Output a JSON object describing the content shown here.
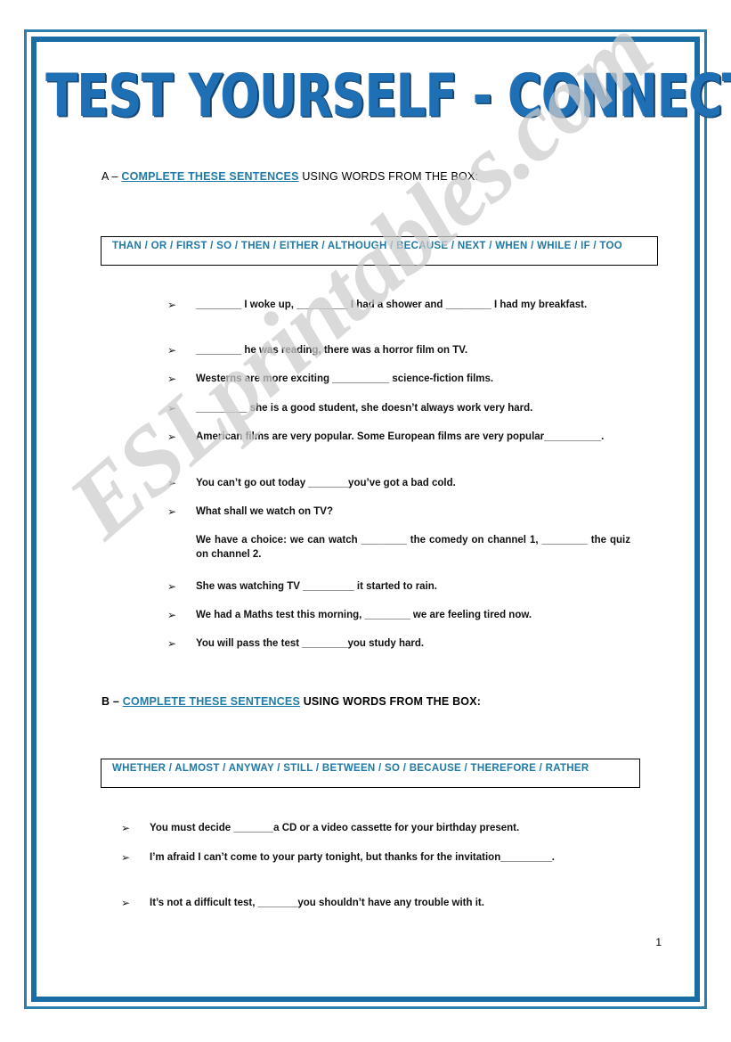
{
  "document": {
    "title": "TEST YOURSELF - CONNECTORS",
    "page_number": "1",
    "watermark": "ESLprintables.com",
    "accent_blue": "#1f6fb5",
    "wordbox_blue": "#2079a6",
    "frame_blue": "#1a6ca4"
  },
  "sections": [
    {
      "label": "A",
      "heading_prefix": "A – ",
      "heading_emphasis": "COMPLETE THESE SENTENCES",
      "heading_suffix": " USING WORDS FROM THE BOX:",
      "wordbox": "THAN / OR / FIRST / SO / THEN / EITHER / ALTHOUGH / BECAUSE / NEXT / WHEN / WHILE / IF / TOO",
      "items": [
        "________  I woke up, _________ I had a shower and ________ I had my breakfast.",
        "________ he was reading, there was a horror film on TV.",
        "Westerns are more exciting __________ science-fiction films.",
        "_________ she is a good student, she doesn’t always work very hard.",
        "American films are very popular. Some European films are very popular__________.",
        "You can’t go out today _______you’ve got a bad cold.",
        "What shall we watch on TV?",
        "We have a choice: we can watch ________ the comedy on channel 1, ________ the quiz on channel 2.",
        "She was watching TV _________ it started to rain.",
        "We had a Maths test this morning, ________ we are feeling tired now.",
        "You will pass the test ________you study hard."
      ]
    },
    {
      "label": "B",
      "heading_prefix": "B – ",
      "heading_emphasis": "COMPLETE THESE SENTENCES",
      "heading_suffix": " USING WORDS FROM THE BOX:",
      "wordbox": "WHETHER / ALMOST / ANYWAY / STILL / BETWEEN / SO / BECAUSE / THEREFORE / RATHER",
      "items": [
        "You must decide _______a CD or a video cassette for your birthday present.",
        "I’m afraid I can’t come to your party tonight, but thanks for the invitation_________.",
        "It’s not a difficult test, _______you shouldn’t have any trouble with it."
      ]
    }
  ],
  "icons": {
    "bullet": "➢"
  }
}
